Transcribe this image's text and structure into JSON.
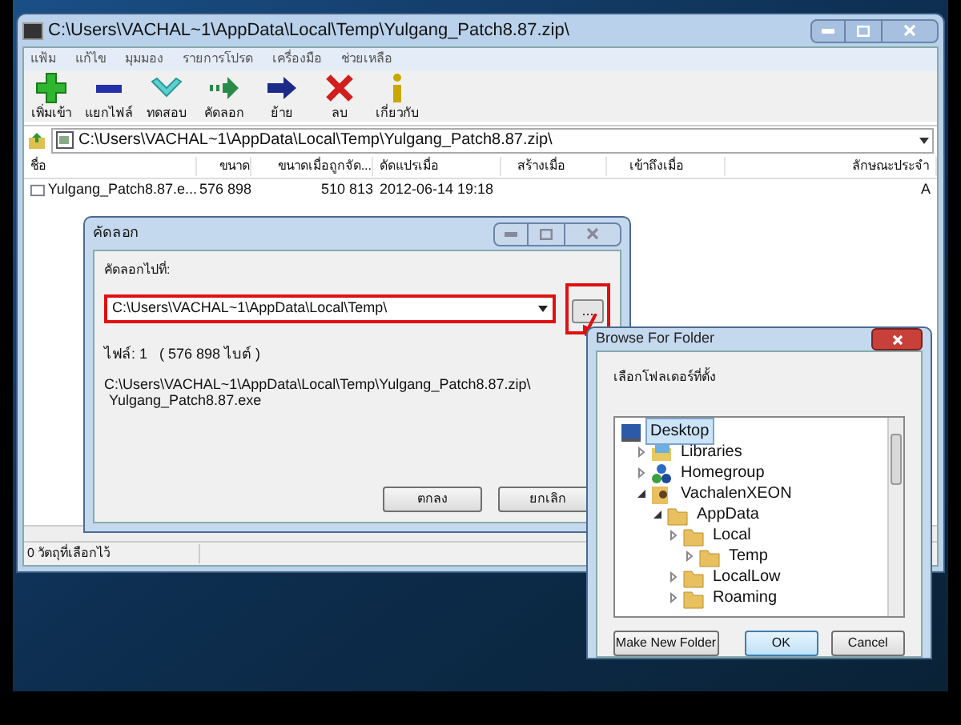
{
  "main_window": {
    "title": "C:\\Users\\VACHAL~1\\AppData\\Local\\Temp\\Yulgang_Patch8.87.zip\\",
    "menu": [
      "แฟ้ม",
      "แก้ไข",
      "มุมมอง",
      "รายการโปรด",
      "เครื่องมือ",
      "ช่วยเหลือ"
    ],
    "toolbar": [
      {
        "label": "เพิ่มเข้า",
        "kind": "add"
      },
      {
        "label": "แยกไฟล์",
        "kind": "extract"
      },
      {
        "label": "ทดสอบ",
        "kind": "test"
      },
      {
        "label": "คัดลอก",
        "kind": "copy"
      },
      {
        "label": "ย้าย",
        "kind": "move"
      },
      {
        "label": "ลบ",
        "kind": "delete"
      },
      {
        "label": "เกี่ยวกับ",
        "kind": "info"
      }
    ],
    "address": "C:\\Users\\VACHAL~1\\AppData\\Local\\Temp\\Yulgang_Patch8.87.zip\\",
    "columns": [
      "ชื่อ",
      "ขนาด",
      "ขนาดเมื่อถูกจัด...",
      "ดัดแปรเมื่อ",
      "สร้างเมื่อ",
      "เข้าถึงเมื่อ",
      "ลักษณะประจำ"
    ],
    "rows": [
      {
        "name": "Yulgang_Patch8.87.e...",
        "size": "576 898",
        "packed": "510 813",
        "modified": "2012-06-14 19:18",
        "attributes": "A"
      }
    ],
    "status_bar": "0 วัตถุที่เลือกไว้"
  },
  "copy_dialog": {
    "title": "คัดลอก",
    "label": "คัดลอกไปที่:",
    "destination": {
      "value": "C:\\Users\\VACHAL~1\\AppData\\Local\\Temp\\",
      "highlighted": true
    },
    "browse_button": {
      "label": "...",
      "highlighted": true
    },
    "file_info": "ไฟล์: 1   ( 576 898 ไบต์ )",
    "source_path": [
      "C:\\Users\\VACHAL~1\\AppData\\Local\\Temp\\Yulgang_Patch8.87.zip\\",
      "Yulgang_Patch8.87.exe"
    ],
    "buttons": [
      "ตกลง",
      "ยกเลิก"
    ]
  },
  "browse_dialog": {
    "title": "Browse For Folder",
    "instruction": "เลือกโฟลเดอร์ที่ตั้ง",
    "tree": [
      {
        "label": "Desktop",
        "kind": "desktop",
        "selected": true,
        "children": [
          {
            "label": "Libraries",
            "kind": "libraries",
            "selected": false,
            "expanded": false
          },
          {
            "label": "Homegroup",
            "kind": "homegroup",
            "selected": false,
            "expanded": false
          },
          {
            "label": "VachalenXEON",
            "kind": "user",
            "selected": false,
            "expanded": true,
            "children": [
              {
                "label": "AppData",
                "kind": "folder",
                "selected": false,
                "expanded": true,
                "children": [
                  {
                    "label": "Local",
                    "kind": "folder",
                    "selected": false,
                    "expanded": false
                  },
                  {
                    "label": "Temp",
                    "kind": "folder",
                    "selected": false,
                    "expanded": false,
                    "nested": true
                  },
                  {
                    "label": "LocalLow",
                    "kind": "folder",
                    "selected": false,
                    "expanded": false
                  },
                  {
                    "label": "Roaming",
                    "kind": "folder",
                    "selected": false,
                    "expanded": false
                  }
                ]
              }
            ]
          }
        ]
      }
    ],
    "buttons": [
      {
        "label": "Make New Folder",
        "selected": false
      },
      {
        "label": "OK",
        "selected": true
      },
      {
        "label": "Cancel",
        "selected": false
      }
    ]
  }
}
